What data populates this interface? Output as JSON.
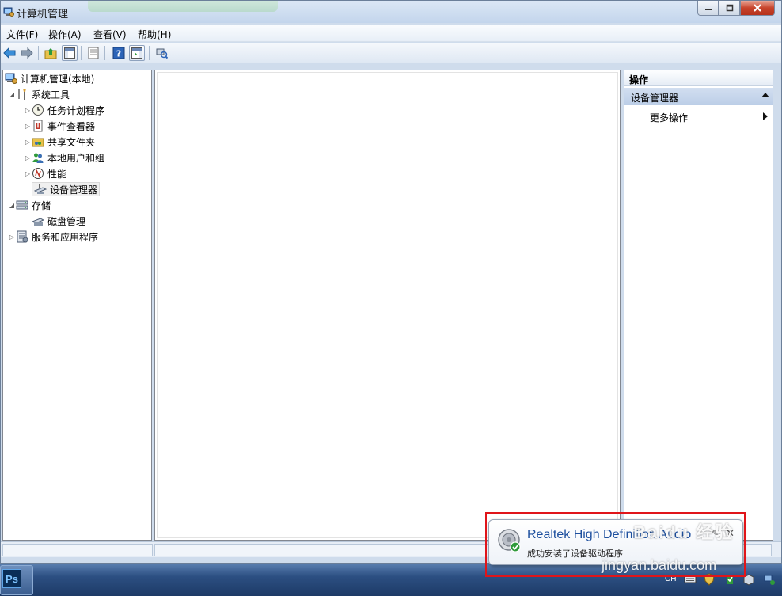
{
  "window": {
    "title": "计算机管理",
    "icon": "computer-management-icon"
  },
  "menu": [
    "文件(F)",
    "操作(A)",
    "查看(V)",
    "帮助(H)"
  ],
  "toolbar": {
    "icons": [
      "back-arrow-icon",
      "forward-arrow-icon",
      "up-folder-icon",
      "show-hide-tree-icon",
      "properties-icon",
      "help-icon",
      "show-action-pane-icon",
      "device-scan-icon"
    ]
  },
  "tree": {
    "root": "计算机管理(本地)",
    "system_tools": "系统工具",
    "task_scheduler": "任务计划程序",
    "event_viewer": "事件查看器",
    "shared_folders": "共享文件夹",
    "local_users": "本地用户和组",
    "performance": "性能",
    "device_manager": "设备管理器",
    "storage": "存储",
    "disk_management": "磁盘管理",
    "services_apps": "服务和应用程序"
  },
  "actions": {
    "header": "操作",
    "group": "设备管理器",
    "more": "更多操作"
  },
  "balloon": {
    "title": "Realtek High Definition Audio",
    "message": "成功安装了设备驱动程序"
  },
  "taskbar": {
    "app": "Ps",
    "lang": "CH"
  },
  "watermark": {
    "brand": "Baidu 经验",
    "url": "jingyan.baidu.com"
  },
  "colors": {
    "highlight": "#e0151a",
    "balloon_title": "#1d4f9e"
  }
}
